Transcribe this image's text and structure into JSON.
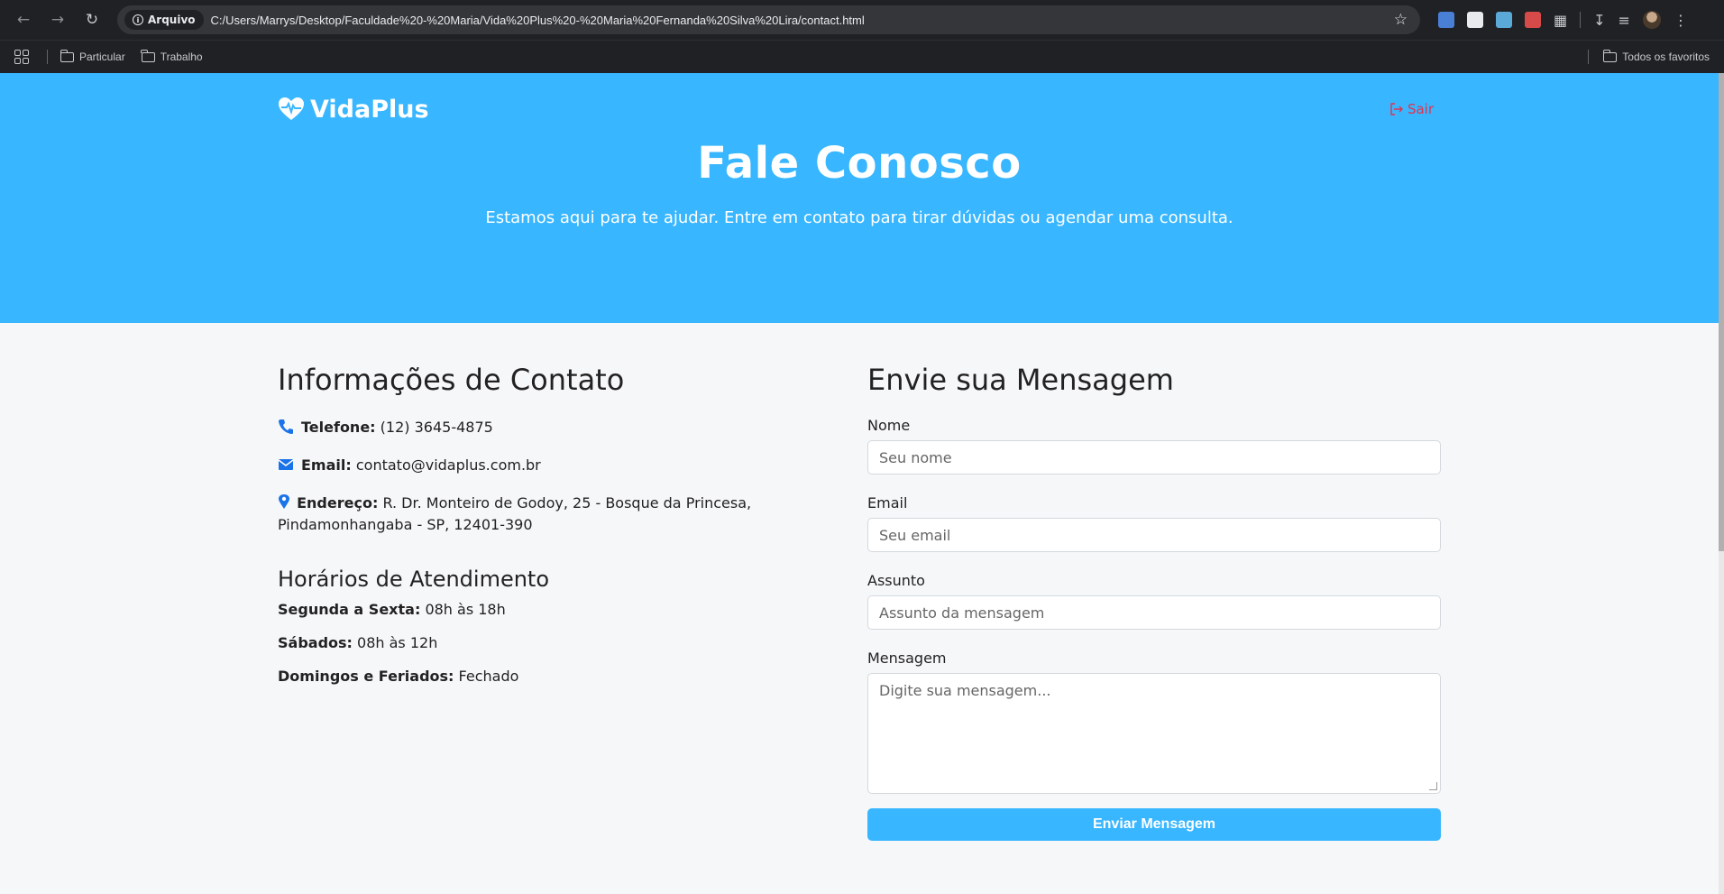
{
  "browser": {
    "site_chip": "Arquivo",
    "url": "C:/Users/Marrys/Desktop/Faculdade%20-%20Maria/Vida%20Plus%20-%20Maria%20Fernanda%20Silva%20Lira/contact.html",
    "bookmarks": [
      "Particular",
      "Trabalho"
    ],
    "all_bookmarks": "Todos os favoritos"
  },
  "nav": {
    "brand": "VidaPlus",
    "logout": "Sair"
  },
  "hero": {
    "title": "Fale Conosco",
    "subtitle": "Estamos aqui para te ajudar. Entre em contato para tirar dúvidas ou agendar uma consulta."
  },
  "contact": {
    "heading": "Informações de Contato",
    "phone_label": "Telefone:",
    "phone": "(12) 3645-4875",
    "email_label": "Email:",
    "email": "contato@vidaplus.com.br",
    "address_label": "Endereço:",
    "address_line1": "R. Dr. Monteiro de Godoy, 25 - Bosque da Princesa,",
    "address_line2": "Pindamonhangaba - SP, 12401-390"
  },
  "hours": {
    "heading": "Horários de Atendimento",
    "items": [
      {
        "label": "Segunda a Sexta:",
        "value": "08h às 18h"
      },
      {
        "label": "Sábados:",
        "value": "08h às 12h"
      },
      {
        "label": "Domingos e Feriados:",
        "value": "Fechado"
      }
    ]
  },
  "form": {
    "heading": "Envie sua Mensagem",
    "name_label": "Nome",
    "name_placeholder": "Seu nome",
    "email_label": "Email",
    "email_placeholder": "Seu email",
    "subject_label": "Assunto",
    "subject_placeholder": "Assunto da mensagem",
    "message_label": "Mensagem",
    "message_placeholder": "Digite sua mensagem...",
    "submit": "Enviar Mensagem"
  },
  "colors": {
    "primary": "#38b6ff",
    "logout": "#e0344f",
    "icon": "#1a73e8"
  }
}
